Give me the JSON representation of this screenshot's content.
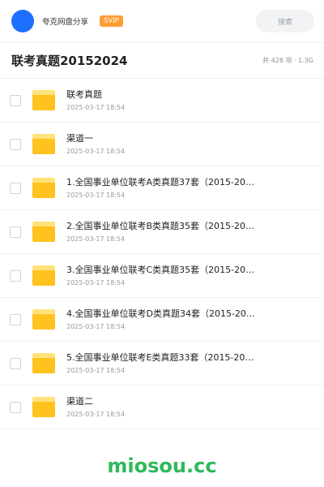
{
  "topbar": {
    "user_name": "夸克网盘分享",
    "badge": "SVIP",
    "search_placeholder": "搜索",
    "avatar_color": "#1f6fff"
  },
  "header": {
    "title": "联考真题20152024",
    "meta": "共 426 项 · 1.3G"
  },
  "files": [
    {
      "name": "联考真题",
      "date": "2025-03-17 18:54",
      "icon": "folder-icon"
    },
    {
      "name": "渠道一",
      "date": "2025-03-17 18:54",
      "icon": "folder-icon"
    },
    {
      "name": "1.全国事业单位联考A类真题37套（2015-20…",
      "date": "2025-03-17 18:54",
      "icon": "folder-icon"
    },
    {
      "name": "2.全国事业单位联考B类真题35套（2015-20…",
      "date": "2025-03-17 18:54",
      "icon": "folder-icon"
    },
    {
      "name": "3.全国事业单位联考C类真题35套（2015-20…",
      "date": "2025-03-17 18:54",
      "icon": "folder-icon"
    },
    {
      "name": "4.全国事业单位联考D类真题34套（2015-20…",
      "date": "2025-03-17 18:54",
      "icon": "folder-icon"
    },
    {
      "name": "5.全国事业单位联考E类真题33套（2015-20…",
      "date": "2025-03-17 18:54",
      "icon": "folder-icon"
    },
    {
      "name": "渠道二",
      "date": "2025-03-17 18:54",
      "icon": "folder-icon"
    }
  ],
  "watermark": "miosou.cc",
  "colors": {
    "svip": "#ff9b32",
    "folder": "#ffc21f",
    "watermark": "#2fb85a"
  }
}
